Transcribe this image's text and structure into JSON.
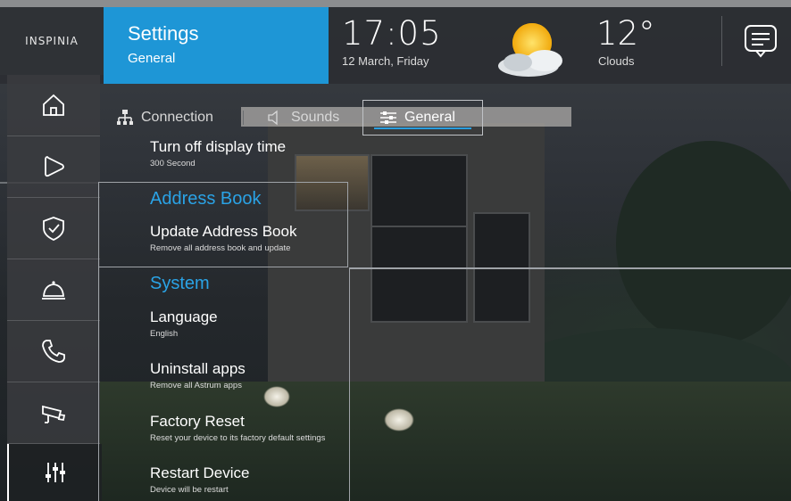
{
  "brand": {
    "logo_text": "INSPINIA"
  },
  "header": {
    "title": "Settings",
    "subtitle": "General",
    "time": "17:05",
    "date": "12 March, Friday",
    "temperature": "12°",
    "condition": "Clouds",
    "weather_icon": "sun-cloud-icon",
    "accent_color": "#1e96d6"
  },
  "sidebar": {
    "items": [
      {
        "name": "home",
        "icon": "home-icon"
      },
      {
        "name": "play",
        "icon": "play-icon"
      },
      {
        "name": "security",
        "icon": "shield-check-icon"
      },
      {
        "name": "service",
        "icon": "service-bell-icon"
      },
      {
        "name": "phone",
        "icon": "phone-icon"
      },
      {
        "name": "camera",
        "icon": "cctv-camera-icon"
      },
      {
        "name": "settings",
        "icon": "sliders-icon",
        "active": true
      }
    ]
  },
  "tabs": [
    {
      "label": "Connection",
      "icon": "network-icon"
    },
    {
      "label": "Sounds",
      "icon": "speaker-icon"
    },
    {
      "label": "General",
      "icon": "sliders-h-icon",
      "selected": true
    }
  ],
  "settings": {
    "display": {
      "title": "Turn off display time",
      "subtitle": "300 Second"
    },
    "address_book_section": "Address Book",
    "address_book": {
      "title": "Update Address Book",
      "subtitle": "Remove all address book and update"
    },
    "system_section": "System",
    "language": {
      "title": "Language",
      "subtitle": "English"
    },
    "uninstall": {
      "title": "Uninstall apps",
      "subtitle": "Remove all Astrum apps"
    },
    "factory_reset": {
      "title": "Factory Reset",
      "subtitle": "Reset your device to its factory default settings"
    },
    "restart": {
      "title": "Restart Device",
      "subtitle": "Device will be restart"
    }
  }
}
